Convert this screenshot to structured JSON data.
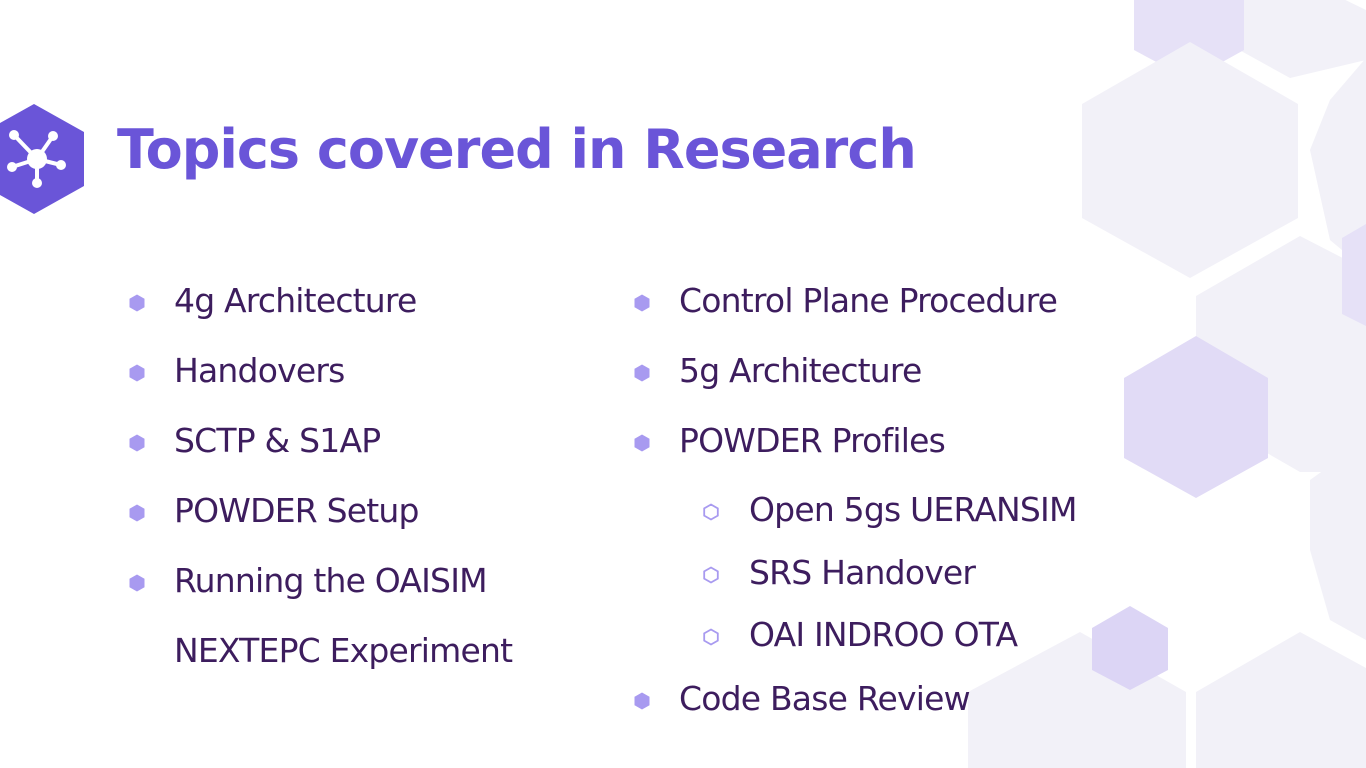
{
  "slide": {
    "title": "Topics covered in Research",
    "title_icon": "network-hub-icon",
    "left_column": [
      {
        "text": "4g Architecture",
        "bullet": "filled-hexagon"
      },
      {
        "text": "Handovers",
        "bullet": "filled-hexagon"
      },
      {
        "text": "SCTP & S1AP",
        "bullet": "filled-hexagon"
      },
      {
        "text": "POWDER Setup",
        "bullet": "filled-hexagon"
      },
      {
        "text": "Running the OAISIM",
        "bullet": "filled-hexagon"
      },
      {
        "text": "NEXTEPC Experiment",
        "bullet": "none"
      }
    ],
    "right_column": [
      {
        "text": "Control Plane Procedure",
        "bullet": "filled-hexagon"
      },
      {
        "text": "5g Architecture",
        "bullet": "filled-hexagon"
      },
      {
        "text": "POWDER Profiles",
        "bullet": "filled-hexagon"
      },
      {
        "text": "Open 5gs UERANSIM",
        "bullet": "outline-hexagon"
      },
      {
        "text": "SRS Handover",
        "bullet": "outline-hexagon"
      },
      {
        "text": "OAI INDROO OTA",
        "bullet": "outline-hexagon"
      },
      {
        "text": "Code Base Review",
        "bullet": "filled-hexagon"
      }
    ]
  },
  "colors": {
    "title": "#6A55D8",
    "text": "#3D1D5E",
    "bullet": "#A89AF0",
    "icon_bg": "#6A55D8",
    "hex_light": "#EFEDF6",
    "hex_accent": "#D9D2F4"
  }
}
